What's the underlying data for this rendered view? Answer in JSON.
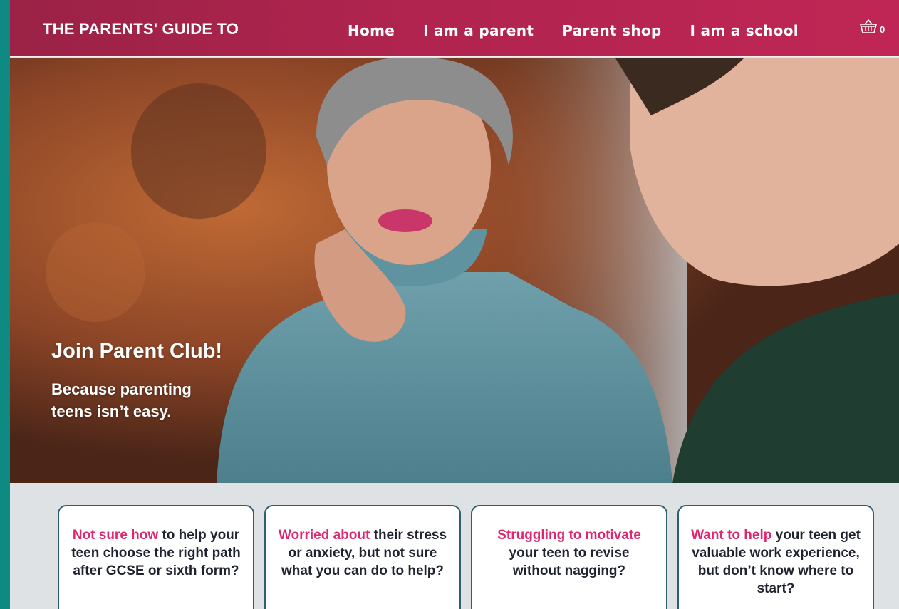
{
  "header": {
    "brand": "THE PARENTS' GUIDE TO",
    "nav": [
      {
        "label": "Home"
      },
      {
        "label": "I am a parent"
      },
      {
        "label": "Parent shop"
      },
      {
        "label": "I am a school"
      }
    ],
    "cart_count": "0",
    "cart_icon": "basket-icon"
  },
  "hero": {
    "title": "Join Parent Club!",
    "subtitle": "Because parenting teens isn’t easy."
  },
  "cards": [
    {
      "highlight": "Not sure how",
      "rest": " to help your teen choose the right path after GCSE or sixth form?"
    },
    {
      "highlight": "Worried about",
      "rest": " their stress or anxiety, but not sure what you can do to help?"
    },
    {
      "highlight": "Struggling to motivate",
      "rest": " your teen to revise without nagging?"
    },
    {
      "highlight": "Want to help",
      "rest": " your teen get valuable work experience, but don’t know where to start?"
    }
  ],
  "colors": {
    "header_bg": "#b0244f",
    "accent": "#e0266e",
    "page_border": "#0f8a82",
    "card_border": "#2f5f6e"
  }
}
